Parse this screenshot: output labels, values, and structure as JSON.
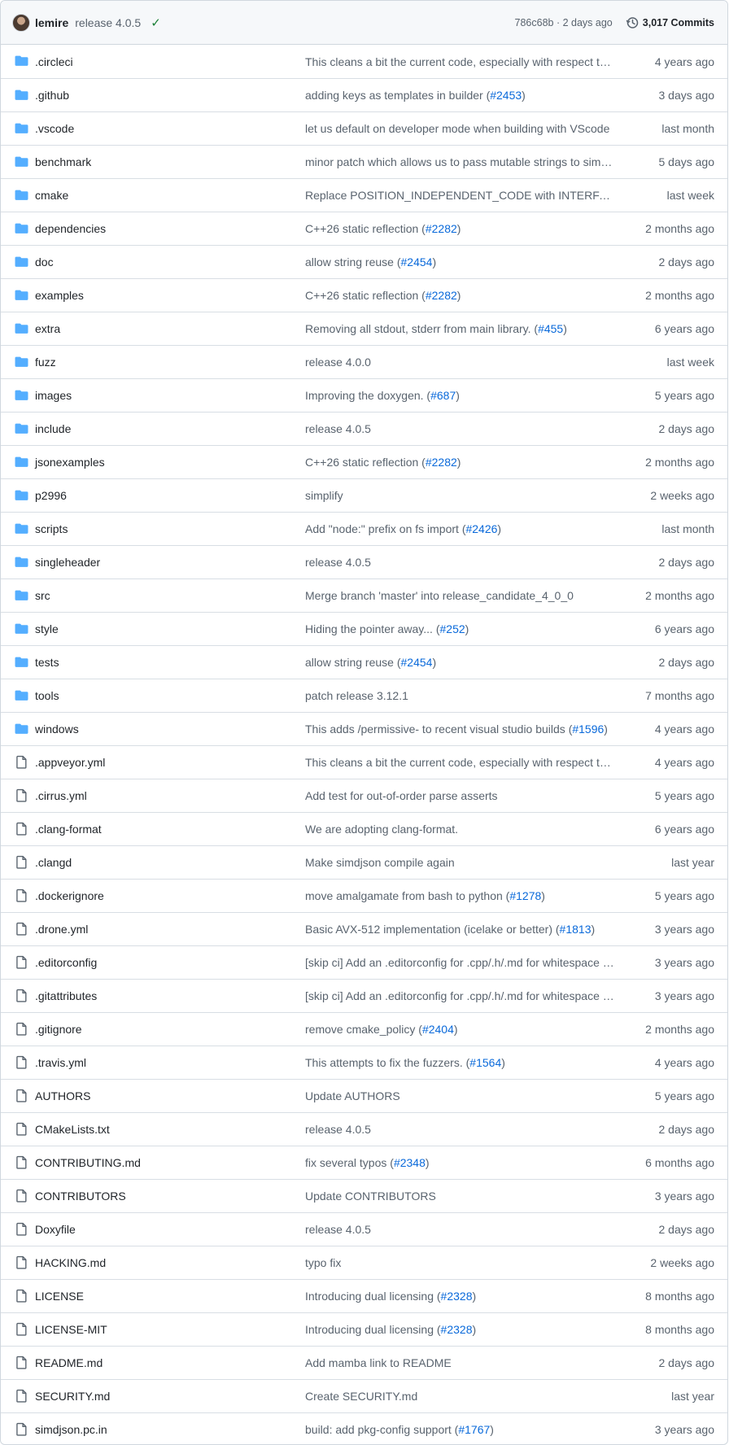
{
  "header": {
    "author": "lemire",
    "message": "release 4.0.5",
    "check_icon": "check-icon",
    "meta": "786c68b · 2 days ago",
    "commits_label": "3,017 Commits",
    "commits_icon": "history-icon"
  },
  "colors": {
    "folder": "#54aeff",
    "file": "#59636e",
    "link": "#0969da",
    "check": "#1a7f37"
  },
  "files": [
    {
      "type": "dir",
      "name": ".circleci",
      "message": "This cleans a bit the current code, especially with respect to …",
      "pr": "",
      "suffix": "",
      "age": "4 years ago"
    },
    {
      "type": "dir",
      "name": ".github",
      "message": "adding keys as templates in builder (",
      "pr": "#2453",
      "suffix": ")",
      "age": "3 days ago"
    },
    {
      "type": "dir",
      "name": ".vscode",
      "message": "let us default on developer mode when building with VScode",
      "pr": "",
      "suffix": "",
      "age": "last month"
    },
    {
      "type": "dir",
      "name": "benchmark",
      "message": "minor patch which allows us to pass mutable strings to simd…",
      "pr": "",
      "suffix": "",
      "age": "5 days ago"
    },
    {
      "type": "dir",
      "name": "cmake",
      "message": "Replace POSITION_INDEPENDENT_CODE with INTERFACE_P…",
      "pr": "",
      "suffix": "",
      "age": "last week"
    },
    {
      "type": "dir",
      "name": "dependencies",
      "message": "C++26 static reflection (",
      "pr": "#2282",
      "suffix": ")",
      "age": "2 months ago"
    },
    {
      "type": "dir",
      "name": "doc",
      "message": "allow string reuse (",
      "pr": "#2454",
      "suffix": ")",
      "age": "2 days ago"
    },
    {
      "type": "dir",
      "name": "examples",
      "message": "C++26 static reflection (",
      "pr": "#2282",
      "suffix": ")",
      "age": "2 months ago"
    },
    {
      "type": "dir",
      "name": "extra",
      "message": "Removing all stdout, stderr from main library. (",
      "pr": "#455",
      "suffix": ")",
      "age": "6 years ago"
    },
    {
      "type": "dir",
      "name": "fuzz",
      "message": "release 4.0.0",
      "pr": "",
      "suffix": "",
      "age": "last week"
    },
    {
      "type": "dir",
      "name": "images",
      "message": "Improving the doxygen. (",
      "pr": "#687",
      "suffix": ")",
      "age": "5 years ago"
    },
    {
      "type": "dir",
      "name": "include",
      "message": "release 4.0.5",
      "pr": "",
      "suffix": "",
      "age": "2 days ago"
    },
    {
      "type": "dir",
      "name": "jsonexamples",
      "message": "C++26 static reflection (",
      "pr": "#2282",
      "suffix": ")",
      "age": "2 months ago"
    },
    {
      "type": "dir",
      "name": "p2996",
      "message": "simplify",
      "pr": "",
      "suffix": "",
      "age": "2 weeks ago"
    },
    {
      "type": "dir",
      "name": "scripts",
      "message": "Add \"node:\" prefix on fs import (",
      "pr": "#2426",
      "suffix": ")",
      "age": "last month"
    },
    {
      "type": "dir",
      "name": "singleheader",
      "message": "release 4.0.5",
      "pr": "",
      "suffix": "",
      "age": "2 days ago"
    },
    {
      "type": "dir",
      "name": "src",
      "message": "Merge branch 'master' into release_candidate_4_0_0",
      "pr": "",
      "suffix": "",
      "age": "2 months ago"
    },
    {
      "type": "dir",
      "name": "style",
      "message": "Hiding the pointer away... (",
      "pr": "#252",
      "suffix": ")",
      "age": "6 years ago"
    },
    {
      "type": "dir",
      "name": "tests",
      "message": "allow string reuse (",
      "pr": "#2454",
      "suffix": ")",
      "age": "2 days ago"
    },
    {
      "type": "dir",
      "name": "tools",
      "message": "patch release 3.12.1",
      "pr": "",
      "suffix": "",
      "age": "7 months ago"
    },
    {
      "type": "dir",
      "name": "windows",
      "message": "This adds /permissive- to recent visual studio builds (",
      "pr": "#1596",
      "suffix": ")",
      "age": "4 years ago"
    },
    {
      "type": "file",
      "name": ".appveyor.yml",
      "message": "This cleans a bit the current code, especially with respect to …",
      "pr": "",
      "suffix": "",
      "age": "4 years ago"
    },
    {
      "type": "file",
      "name": ".cirrus.yml",
      "message": "Add test for out-of-order parse asserts",
      "pr": "",
      "suffix": "",
      "age": "5 years ago"
    },
    {
      "type": "file",
      "name": ".clang-format",
      "message": "We are adopting clang-format.",
      "pr": "",
      "suffix": "",
      "age": "6 years ago"
    },
    {
      "type": "file",
      "name": ".clangd",
      "message": "Make simdjson compile again",
      "pr": "",
      "suffix": "",
      "age": "last year"
    },
    {
      "type": "file",
      "name": ".dockerignore",
      "message": "move amalgamate from bash to python (",
      "pr": "#1278",
      "suffix": ")",
      "age": "5 years ago"
    },
    {
      "type": "file",
      "name": ".drone.yml",
      "message": "Basic AVX-512 implementation (icelake or better) (",
      "pr": "#1813",
      "suffix": ")",
      "age": "3 years ago"
    },
    {
      "type": "file",
      "name": ".editorconfig",
      "message": "[skip ci] Add an .editorconfig for .cpp/.h/.md for whitespace …",
      "pr": "",
      "suffix": "",
      "age": "3 years ago"
    },
    {
      "type": "file",
      "name": ".gitattributes",
      "message": "[skip ci] Add an .editorconfig for .cpp/.h/.md for whitespace …",
      "pr": "",
      "suffix": "",
      "age": "3 years ago"
    },
    {
      "type": "file",
      "name": ".gitignore",
      "message": "remove cmake_policy (",
      "pr": "#2404",
      "suffix": ")",
      "age": "2 months ago"
    },
    {
      "type": "file",
      "name": ".travis.yml",
      "message": "This attempts to fix the fuzzers. (",
      "pr": "#1564",
      "suffix": ")",
      "age": "4 years ago"
    },
    {
      "type": "file",
      "name": "AUTHORS",
      "message": "Update AUTHORS",
      "pr": "",
      "suffix": "",
      "age": "5 years ago"
    },
    {
      "type": "file",
      "name": "CMakeLists.txt",
      "message": "release 4.0.5",
      "pr": "",
      "suffix": "",
      "age": "2 days ago"
    },
    {
      "type": "file",
      "name": "CONTRIBUTING.md",
      "message": "fix several typos (",
      "pr": "#2348",
      "suffix": ")",
      "age": "6 months ago"
    },
    {
      "type": "file",
      "name": "CONTRIBUTORS",
      "message": "Update CONTRIBUTORS",
      "pr": "",
      "suffix": "",
      "age": "3 years ago"
    },
    {
      "type": "file",
      "name": "Doxyfile",
      "message": "release 4.0.5",
      "pr": "",
      "suffix": "",
      "age": "2 days ago"
    },
    {
      "type": "file",
      "name": "HACKING.md",
      "message": "typo fix",
      "pr": "",
      "suffix": "",
      "age": "2 weeks ago"
    },
    {
      "type": "file",
      "name": "LICENSE",
      "message": "Introducing dual licensing (",
      "pr": "#2328",
      "suffix": ")",
      "age": "8 months ago"
    },
    {
      "type": "file",
      "name": "LICENSE-MIT",
      "message": "Introducing dual licensing (",
      "pr": "#2328",
      "suffix": ")",
      "age": "8 months ago"
    },
    {
      "type": "file",
      "name": "README.md",
      "message": "Add mamba link to README",
      "pr": "",
      "suffix": "",
      "age": "2 days ago"
    },
    {
      "type": "file",
      "name": "SECURITY.md",
      "message": "Create SECURITY.md",
      "pr": "",
      "suffix": "",
      "age": "last year"
    },
    {
      "type": "file",
      "name": "simdjson.pc.in",
      "message": "build: add pkg-config support (",
      "pr": "#1767",
      "suffix": ")",
      "age": "3 years ago"
    }
  ]
}
